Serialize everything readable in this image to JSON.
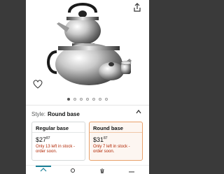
{
  "product_gallery": {
    "image_alt": "Stainless steel double teapot set",
    "dots_count": 7,
    "active_dot": 0
  },
  "style_selector": {
    "label": "Style:",
    "selected_value": "Round base"
  },
  "options": [
    {
      "title": "Regular base",
      "price_whole": "$27",
      "price_fraction": "87",
      "stock": "Only 13 left in stock - order soon."
    },
    {
      "title": "Round base",
      "price_whole": "$31",
      "price_fraction": "87",
      "stock": "Only 7 left in stock - order soon."
    }
  ],
  "colors": {
    "selected_border": "#e8a06a",
    "stock_text": "#b12704",
    "nav_accent": "#1a8098"
  }
}
